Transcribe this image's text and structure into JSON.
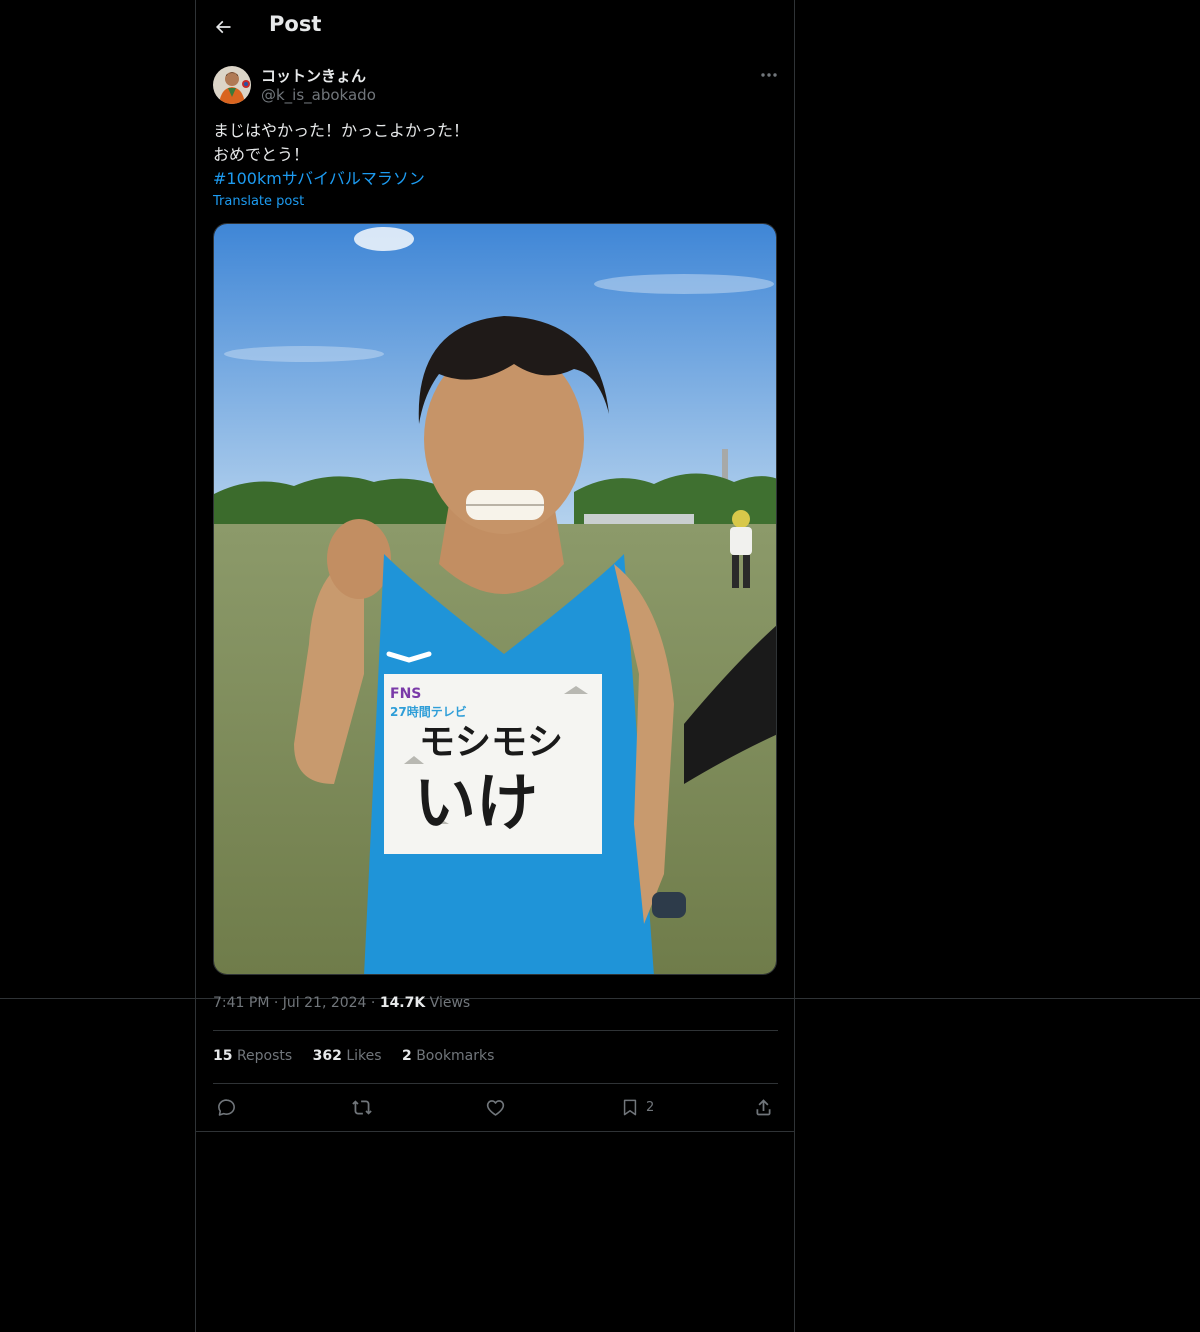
{
  "header": {
    "title": "Post"
  },
  "author": {
    "display_name": "コットンきょん",
    "handle": "@k_is_abokado"
  },
  "post": {
    "lines": [
      "まじはやかった！かっこよかった！",
      "おめでとう！"
    ],
    "hashtag": "#100kmサバイバルマラソン",
    "translate_label": "Translate post"
  },
  "media": {
    "bib": {
      "logo_top": "FNS",
      "logo_bottom": "27時間テレビ",
      "line1": "モシモシ",
      "line2": "いけ"
    }
  },
  "meta": {
    "time": "7:41 PM",
    "separator": "·",
    "date": "Jul 21, 2024",
    "views_count": "14.7K",
    "views_label": "Views"
  },
  "stats": {
    "reposts_count": "15",
    "reposts_label": "Reposts",
    "likes_count": "362",
    "likes_label": "Likes",
    "bookmarks_count": "2",
    "bookmarks_label": "Bookmarks"
  },
  "actions": {
    "bookmark_count": "2"
  },
  "colors": {
    "background": "#000000",
    "text_primary": "#e7e9ea",
    "text_secondary": "#71767b",
    "accent": "#1d9bf0",
    "border": "#2f3336"
  }
}
